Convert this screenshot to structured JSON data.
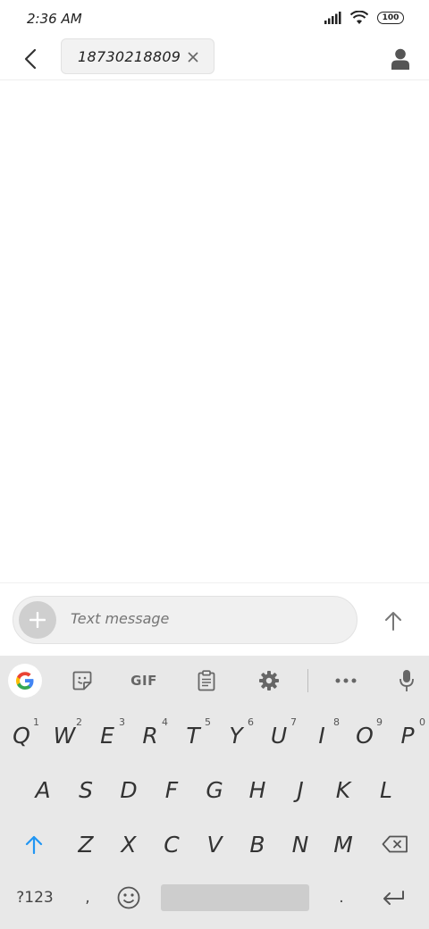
{
  "status_bar": {
    "time": "2:36 AM",
    "battery": "100"
  },
  "header": {
    "recipient": "18730218809",
    "icons": {
      "back": "back-arrow-icon",
      "remove": "close-icon",
      "contact": "person-icon"
    }
  },
  "compose": {
    "placeholder": "Text message",
    "icons": {
      "add": "plus-icon",
      "send": "arrow-up-icon"
    }
  },
  "keyboard_toolbar": {
    "gif_label": "GIF",
    "icons": [
      "google-icon",
      "sticker-icon",
      "gif",
      "clipboard-icon",
      "gear-icon",
      "more-icon",
      "mic-icon"
    ]
  },
  "keyboard": {
    "row1": [
      {
        "key": "Q",
        "hint": "1"
      },
      {
        "key": "W",
        "hint": "2"
      },
      {
        "key": "E",
        "hint": "3"
      },
      {
        "key": "R",
        "hint": "4"
      },
      {
        "key": "T",
        "hint": "5"
      },
      {
        "key": "Y",
        "hint": "6"
      },
      {
        "key": "U",
        "hint": "7"
      },
      {
        "key": "I",
        "hint": "8"
      },
      {
        "key": "O",
        "hint": "9"
      },
      {
        "key": "P",
        "hint": "0"
      }
    ],
    "row2": [
      "A",
      "S",
      "D",
      "F",
      "G",
      "H",
      "J",
      "K",
      "L"
    ],
    "row3": [
      "Z",
      "X",
      "C",
      "V",
      "B",
      "N",
      "M"
    ],
    "symbols_key": "?123",
    "comma_key": ",",
    "period_key": ".",
    "accent_color": "#2196f3"
  }
}
